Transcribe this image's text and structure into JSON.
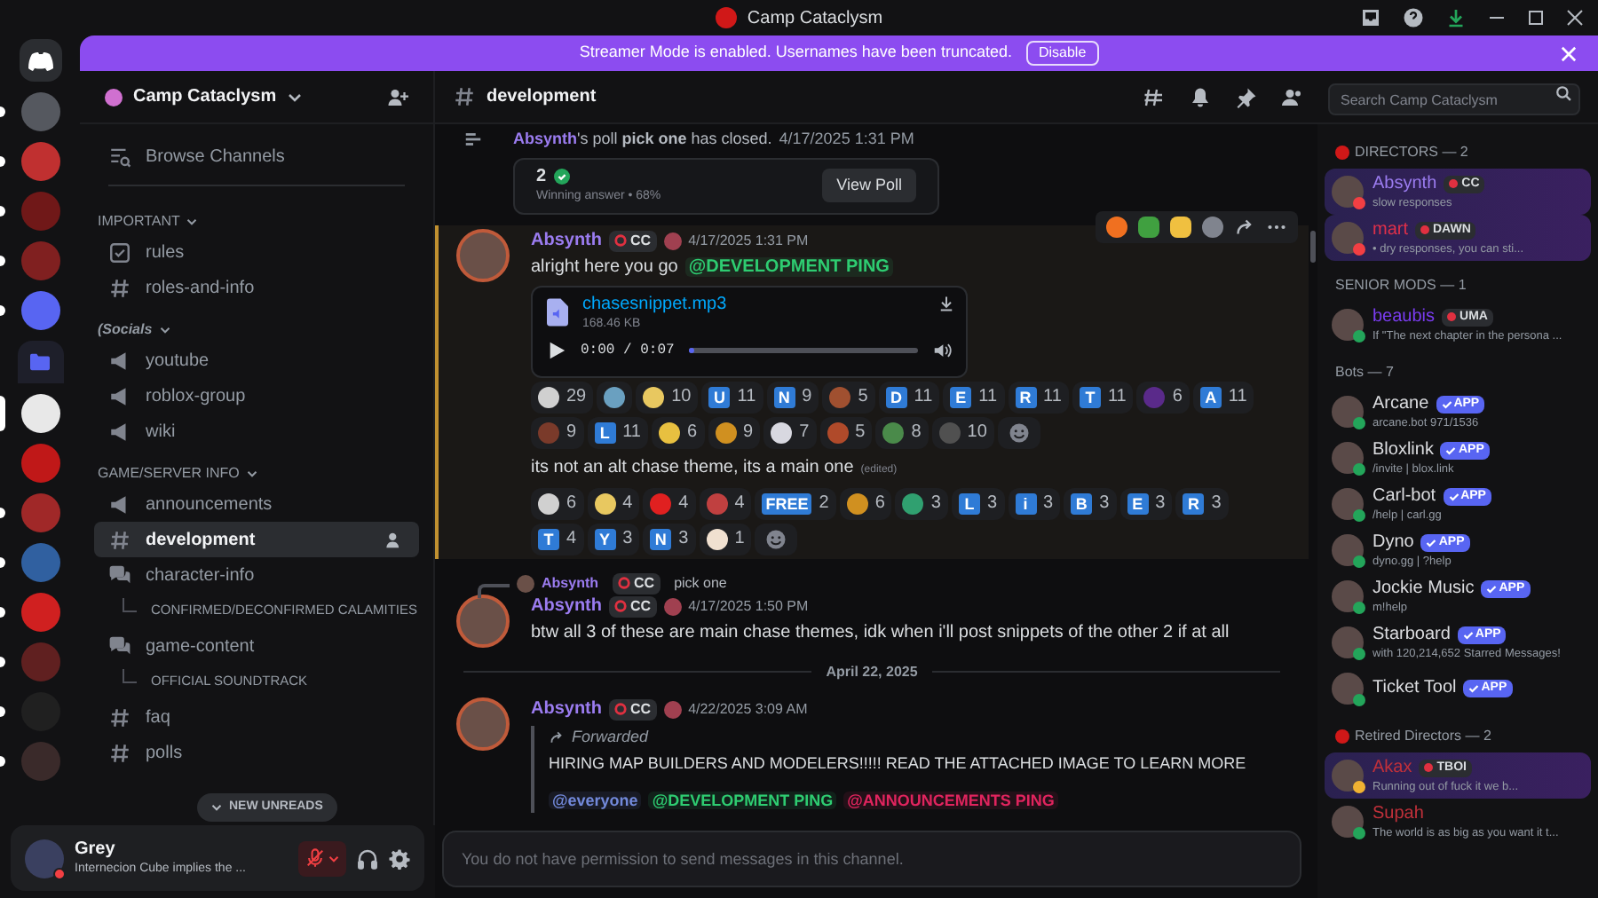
{
  "window": {
    "title": "Camp Cataclysm"
  },
  "banner": {
    "text": "Streamer Mode is enabled. Usernames have been truncated.",
    "button": "Disable"
  },
  "servers": [
    {
      "kind": "home",
      "unread": false
    },
    {
      "kind": "server",
      "unread": true
    },
    {
      "kind": "server",
      "unread": true
    },
    {
      "kind": "server",
      "unread": true
    },
    {
      "kind": "server",
      "unread": true
    },
    {
      "kind": "server",
      "unread": true
    },
    {
      "kind": "folder",
      "unread": false
    },
    {
      "kind": "server",
      "unread": false,
      "selected": true
    },
    {
      "kind": "server",
      "unread": false
    },
    {
      "kind": "server",
      "unread": true
    },
    {
      "kind": "server",
      "unread": true
    },
    {
      "kind": "server",
      "unread": true
    },
    {
      "kind": "server",
      "unread": true
    },
    {
      "kind": "server",
      "unread": true
    },
    {
      "kind": "server",
      "unread": true
    }
  ],
  "sidebar": {
    "server_name": "Camp Cataclysm",
    "items": [
      {
        "kind": "browse",
        "label": "Browse Channels"
      },
      {
        "kind": "category",
        "label": "IMPORTANT"
      },
      {
        "kind": "rules",
        "label": "rules",
        "selected": false
      },
      {
        "kind": "text",
        "label": "roles-and-info",
        "selected": false
      },
      {
        "kind": "category",
        "label": "(Socials",
        "italic": true
      },
      {
        "kind": "announcement",
        "label": "youtube",
        "selected": false
      },
      {
        "kind": "announcement",
        "label": "roblox-group",
        "selected": false
      },
      {
        "kind": "announcement",
        "label": "wiki",
        "selected": false
      },
      {
        "kind": "category",
        "label": "GAME/SERVER INFO"
      },
      {
        "kind": "announcement",
        "label": "announcements",
        "selected": false
      },
      {
        "kind": "text",
        "label": "development",
        "selected": true
      },
      {
        "kind": "forum",
        "label": "character-info",
        "selected": false,
        "children": [
          {
            "label": "CONFIRMED/DECONFIRMED CALAMITIES"
          }
        ]
      },
      {
        "kind": "forum",
        "label": "game-content",
        "selected": false,
        "children": [
          {
            "label": "OFFICIAL SOUNDTRACK"
          }
        ]
      },
      {
        "kind": "text",
        "label": "faq",
        "selected": false
      },
      {
        "kind": "text",
        "label": "polls",
        "selected": false
      }
    ],
    "new_unreads": "NEW UNREADS"
  },
  "user_panel": {
    "name": "Grey",
    "status_text": "Internecion Cube implies the ...",
    "mic_muted": true
  },
  "channel": {
    "name": "development",
    "search_placeholder": "Search Camp Cataclysm"
  },
  "messages": [
    {
      "kind": "poll_result",
      "author": "Absynth",
      "text": "'s poll **pick one** has closed.",
      "time": "4/17/2025 1:31 PM",
      "poll": {
        "answer": "2",
        "detail": "Winning answer • 68%",
        "button": "View Poll"
      }
    },
    {
      "kind": "message",
      "author": "Absynth",
      "tag": "CC",
      "time": "4/17/2025 1:31 PM",
      "hovered": true,
      "text": "alright here you go",
      "mentions": [
        {
          "text": "@DEVELOPMENT PING",
          "color": "#2ecc71"
        }
      ],
      "attachment": {
        "name": "chasesnippet.mp3",
        "size": "168.46 KB",
        "time": "0:00 / 0:07",
        "level": 0.01
      },
      "reactions": [
        {
          "kind": "emoji",
          "color": "#d0d0d0",
          "count": "29"
        },
        {
          "kind": "emoji",
          "color": "#6aa0c0"
        },
        {
          "kind": "emoji",
          "color": "#e8c860",
          "count": "10"
        },
        {
          "kind": "letter",
          "letter": "U",
          "count": "11"
        },
        {
          "kind": "letter",
          "letter": "N",
          "count": "9"
        },
        {
          "kind": "emoji",
          "color": "#a05030",
          "count": "5"
        },
        {
          "kind": "letter",
          "letter": "D",
          "count": "11"
        },
        {
          "kind": "letter",
          "letter": "E",
          "count": "11"
        },
        {
          "kind": "letter",
          "letter": "R",
          "count": "11"
        },
        {
          "kind": "letter",
          "letter": "T",
          "count": "11"
        },
        {
          "kind": "emoji",
          "color": "#5a2a8a",
          "count": "6"
        },
        {
          "kind": "letter",
          "letter": "A",
          "count": "11"
        },
        {
          "kind": "emoji",
          "color": "#7a3a2a",
          "count": "9"
        },
        {
          "kind": "letter",
          "letter": "L",
          "count": "11"
        },
        {
          "kind": "emoji",
          "color": "#e8c040",
          "count": "6"
        },
        {
          "kind": "emoji",
          "color": "#d09020",
          "count": "9"
        },
        {
          "kind": "emoji",
          "color": "#d8d8e0",
          "count": "7"
        },
        {
          "kind": "emoji",
          "color": "#b04a2a",
          "count": "5"
        },
        {
          "kind": "emoji",
          "color": "#4a8a4a",
          "count": "8"
        },
        {
          "kind": "emoji",
          "color": "#505050",
          "count": "10"
        },
        {
          "kind": "add"
        }
      ],
      "continuation": {
        "text": "its not an alt chase theme, its a main one",
        "edited": "(edited)",
        "reactions": [
          {
            "kind": "emoji",
            "color": "#d0d0d0",
            "count": "6"
          },
          {
            "kind": "emoji",
            "color": "#e8c860",
            "count": "4"
          },
          {
            "kind": "emoji",
            "color": "#e02020",
            "count": "4"
          },
          {
            "kind": "emoji",
            "color": "#c04040",
            "count": "4"
          },
          {
            "kind": "letter",
            "letter": "FREE",
            "count": "2"
          },
          {
            "kind": "emoji",
            "color": "#d09020",
            "count": "6"
          },
          {
            "kind": "emoji",
            "color": "#30a070",
            "count": "3"
          },
          {
            "kind": "letter",
            "letter": "L",
            "count": "3"
          },
          {
            "kind": "letter",
            "letter": "i",
            "count": "3"
          },
          {
            "kind": "letter",
            "letter": "B",
            "count": "3"
          },
          {
            "kind": "letter",
            "letter": "E",
            "count": "3"
          },
          {
            "kind": "letter",
            "letter": "R",
            "count": "3"
          },
          {
            "kind": "letter",
            "letter": "T",
            "count": "4"
          },
          {
            "kind": "letter",
            "letter": "Y",
            "count": "3"
          },
          {
            "kind": "letter",
            "letter": "N",
            "count": "3"
          },
          {
            "kind": "emoji",
            "color": "#f0e0d0",
            "count": "1"
          },
          {
            "kind": "add"
          }
        ]
      }
    },
    {
      "kind": "message",
      "author": "Absynth",
      "tag": "CC",
      "time": "4/17/2025 1:50 PM",
      "hovered": false,
      "reply": {
        "author": "Absynth",
        "tag": "CC",
        "text": "pick one"
      },
      "text": "btw all 3 of these are main chase themes, idk when i'll post snippets of the other 2 if at all"
    },
    {
      "kind": "divider",
      "text": "April 22, 2025"
    },
    {
      "kind": "message",
      "author": "Absynth",
      "tag": "CC",
      "time": "4/22/2025 3:09 AM",
      "hovered": false,
      "forwarded": {
        "label": "Forwarded",
        "text": "HIRING MAP BUILDERS AND MODELERS!!!!! READ THE ATTACHED IMAGE TO LEARN MORE",
        "mentions": [
          {
            "text": "@everyone",
            "color": "#7289da"
          },
          {
            "text": "@DEVELOPMENT PING",
            "color": "#2ecc71"
          },
          {
            "text": "@ANNOUNCEMENTS PING",
            "color": "#e0245e"
          }
        ]
      }
    }
  ],
  "composer": {
    "placeholder": "You do not have permission to send messages in this channel."
  },
  "members": [
    {
      "title": "DIRECTORS — 2",
      "icon": true,
      "items": [
        {
          "name": "Absynth",
          "color": "#9b7cf0",
          "tag": {
            "kind": "role",
            "text": "CC"
          },
          "status_text": "slow responses",
          "status_dot": {
            "color": "#f23f43"
          },
          "highlighted": true
        },
        {
          "name": "mart",
          "color": "#e0304a",
          "tag": {
            "kind": "role",
            "text": "DAWN"
          },
          "status_text": "• dry responses, you can sti...",
          "status_dot": {
            "color": "#f23f43"
          },
          "highlighted": true
        }
      ]
    },
    {
      "title": "SENIOR MODS — 1",
      "icon": false,
      "items": [
        {
          "name": "beaubis",
          "color": "#7a3cf0",
          "tag": {
            "kind": "role",
            "text": "UMA"
          },
          "status_text": "If \"The next chapter in the persona ...",
          "status_dot": {
            "color": "#23a55a"
          },
          "highlighted": false
        }
      ]
    },
    {
      "title": "Bots — 7",
      "icon": false,
      "items": [
        {
          "name": "Arcane",
          "color": "#dcdde0",
          "tag": {
            "kind": "app",
            "text": "APP"
          },
          "status_text": "arcane.bot 971/1536",
          "status_dot": {
            "color": "#23a55a"
          },
          "highlighted": false
        },
        {
          "name": "Bloxlink",
          "color": "#dcdde0",
          "tag": {
            "kind": "app",
            "text": "APP"
          },
          "status_text": "/invite | blox.link",
          "status_dot": {
            "color": "#23a55a"
          },
          "highlighted": false
        },
        {
          "name": "Carl-bot",
          "color": "#dcdde0",
          "tag": {
            "kind": "app",
            "text": "APP"
          },
          "status_text": "/help | carl.gg",
          "status_dot": {
            "color": "#23a55a"
          },
          "highlighted": false
        },
        {
          "name": "Dyno",
          "color": "#dcdde0",
          "tag": {
            "kind": "app",
            "text": "APP"
          },
          "status_text": "dyno.gg | ?help",
          "status_dot": {
            "color": "#23a55a"
          },
          "highlighted": false
        },
        {
          "name": "Jockie Music",
          "color": "#dcdde0",
          "tag": {
            "kind": "app",
            "text": "APP"
          },
          "status_text": "m!help",
          "status_dot": {
            "color": "#23a55a"
          },
          "highlighted": false
        },
        {
          "name": "Starboard",
          "color": "#dcdde0",
          "tag": {
            "kind": "app",
            "text": "APP"
          },
          "status_text": "with 120,214,652 Starred Messages!",
          "status_dot": {
            "color": "#23a55a"
          },
          "highlighted": false
        },
        {
          "name": "Ticket Tool",
          "color": "#dcdde0",
          "tag": {
            "kind": "app",
            "text": "APP"
          },
          "status_dot": {
            "color": "#23a55a"
          },
          "highlighted": false
        }
      ]
    },
    {
      "title": "Retired Directors — 2",
      "icon": true,
      "items": [
        {
          "name": "Akax",
          "color": "#c0303a",
          "tag": {
            "kind": "role",
            "text": "TBOI"
          },
          "status_text": "Running out of fuck it we b...",
          "status_dot": {
            "color": "#f0b232"
          },
          "highlighted": true
        },
        {
          "name": "Supah",
          "color": "#c0303a",
          "status_text": "The world is as big as you want it t...",
          "status_dot": {
            "color": "#23a55a"
          },
          "highlighted": false
        }
      ]
    }
  ]
}
